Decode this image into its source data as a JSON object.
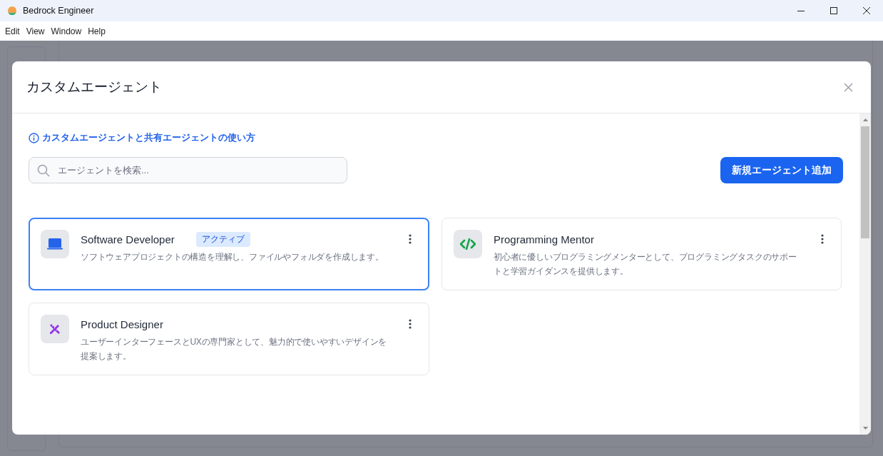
{
  "window": {
    "title": "Bedrock Engineer"
  },
  "menu": [
    "Edit",
    "View",
    "Window",
    "Help"
  ],
  "dialog": {
    "title": "カスタムエージェント",
    "help_link": "カスタムエージェントと共有エージェントの使い方",
    "search": {
      "placeholder": "エージェントを検索..."
    },
    "add_button": "新規エージェント追加",
    "agents": [
      {
        "kind": "laptop",
        "name": "Software Developer",
        "badge": "アクティブ",
        "description": "ソフトウェアプロジェクトの構造を理解し、ファイルやフォルダを作成します。",
        "selected": true
      },
      {
        "kind": "code",
        "name": "Programming Mentor",
        "description": "初心者に優しいプログラミングメンターとして、プログラミングタスクのサポートと学習ガイダンスを提供します。",
        "selected": false
      },
      {
        "kind": "design",
        "name": "Product Designer",
        "description": "ユーザーインターフェースとUXの専門家として、魅力的で使いやすいデザインを提案します。",
        "selected": false
      }
    ]
  }
}
